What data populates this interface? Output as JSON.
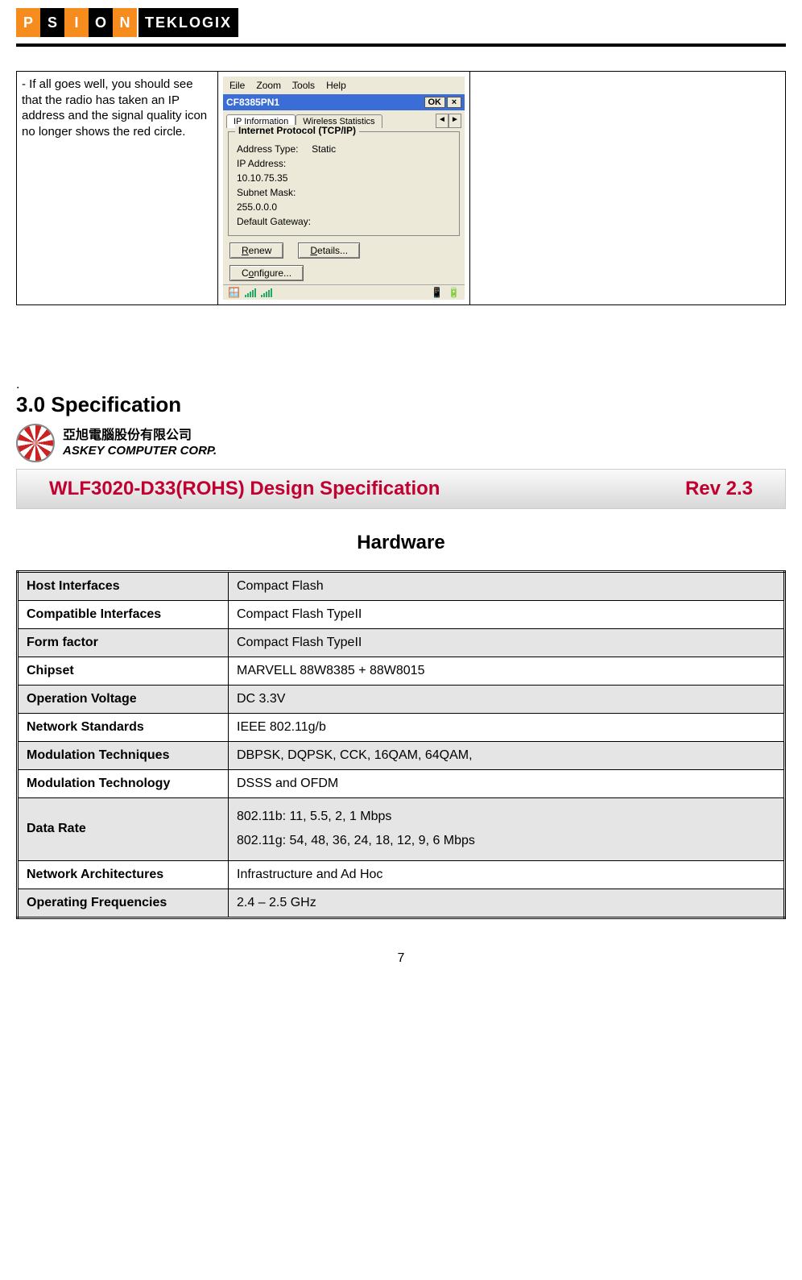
{
  "logo": {
    "brand": "TEKLOGIX",
    "letters": [
      "P",
      "S",
      "I",
      "O",
      "N"
    ]
  },
  "layout": {
    "note": "- If all goes well, you should see that the radio has taken an IP address and the signal quality icon no longer shows the red circle."
  },
  "window": {
    "menu": {
      "file": "File",
      "zoom": "Zoom",
      "tools": "Tools",
      "help": "Help"
    },
    "title": "CF8385PN1",
    "ok": "OK",
    "close": "×",
    "tabs": {
      "active": "IP Information",
      "other": "Wireless Statistics",
      "left": "◄",
      "right": "►"
    },
    "group": {
      "title": "Internet Protocol (TCP/IP)",
      "rows": {
        "addr_type_label": "Address Type:",
        "addr_type_value": "Static",
        "ip_label": "IP Address:",
        "ip_value": "10.10.75.35",
        "mask_label": "Subnet Mask:",
        "mask_value": "255.0.0.0",
        "gw_label": "Default Gateway:"
      }
    },
    "buttons": {
      "renew": "Renew",
      "details": "Details...",
      "configure": "Configure..."
    }
  },
  "section": {
    "heading": "3.0    Specification"
  },
  "askey": {
    "cn": "亞旭電腦股份有限公司",
    "en": "ASKEY COMPUTER CORP."
  },
  "banner": {
    "left": "WLF3020-D33(ROHS) Design Specification",
    "right": "Rev 2.3"
  },
  "hw_title": "Hardware",
  "spec": [
    {
      "label": "Host Interfaces",
      "value": "Compact Flash",
      "shade": true
    },
    {
      "label": "Compatible Interfaces",
      "value": "Compact Flash TypeII",
      "shade": false
    },
    {
      "label": "Form factor",
      "value": "Compact Flash TypeII",
      "shade": true
    },
    {
      "label": "Chipset",
      "value": "MARVELL 88W8385 + 88W8015",
      "shade": false
    },
    {
      "label": "Operation Voltage",
      "value": "DC 3.3V",
      "shade": true
    },
    {
      "label": "Network Standards",
      "value": "IEEE 802.11g/b",
      "shade": false
    },
    {
      "label": "Modulation Techniques",
      "value": "DBPSK, DQPSK, CCK, 16QAM, 64QAM,",
      "shade": true
    },
    {
      "label": "Modulation Technology",
      "value": "DSSS and OFDM",
      "shade": false
    },
    {
      "label": "Data Rate",
      "value_a": "802.11b: 11, 5.5, 2, 1 Mbps",
      "value_b": "802.11g: 54, 48, 36, 24, 18, 12, 9, 6 Mbps",
      "shade": true
    },
    {
      "label": "Network Architectures",
      "value": "Infrastructure and Ad Hoc",
      "shade": false
    },
    {
      "label": "Operating Frequencies",
      "value": "2.4 – 2.5 GHz",
      "shade": true
    }
  ],
  "page_number": "7"
}
